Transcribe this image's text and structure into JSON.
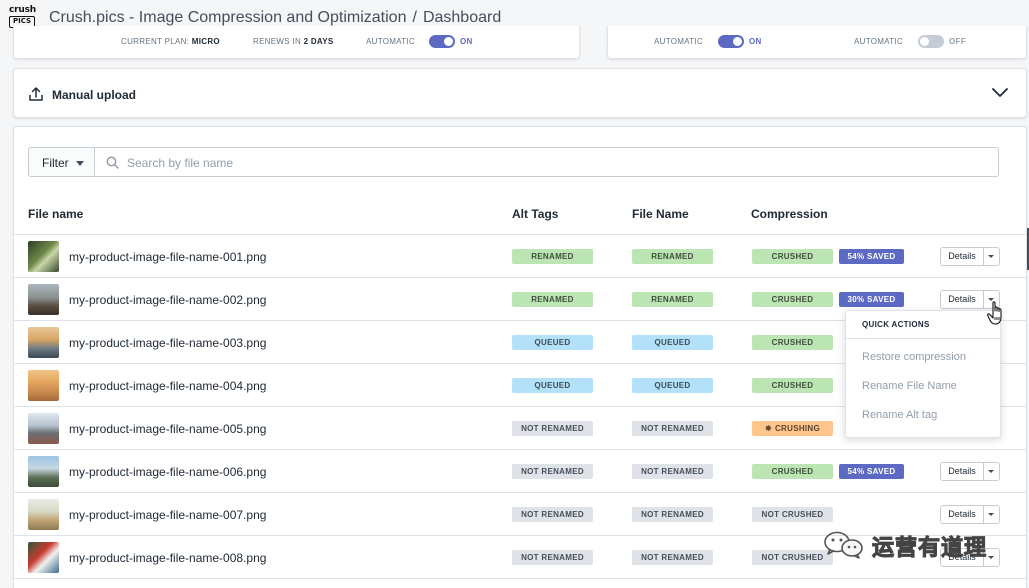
{
  "header": {
    "logo_top": "crush",
    "logo_bottom": "PICS",
    "app_title": "Crush.pics - Image Compression and Optimization",
    "separator": "/",
    "page": "Dashboard"
  },
  "plan": {
    "current_plan_label": "CURRENT PLAN:",
    "current_plan_value": "MICRO",
    "renews_label": "RENEWS IN",
    "renews_value": "2 DAYS",
    "toggles": [
      {
        "label": "AUTOMATIC",
        "state": "ON",
        "on": true
      },
      {
        "label": "AUTOMATIC",
        "state": "ON",
        "on": true
      },
      {
        "label": "AUTOMATIC",
        "state": "OFF",
        "on": false
      }
    ]
  },
  "upload": {
    "label": "Manual upload",
    "icon": "upload-icon"
  },
  "filter": {
    "label": "Filter",
    "search_placeholder": "Search by file name",
    "search_value": ""
  },
  "columns": [
    "File name",
    "Alt Tags",
    "File Name",
    "Compression"
  ],
  "rows": [
    {
      "file": "my-product-image-file-name-001.png",
      "alt": "RENAMED",
      "alt_kind": "green",
      "name": "RENAMED",
      "name_kind": "green",
      "comp": "CRUSHED",
      "comp_kind": "green",
      "saved": "54% SAVED",
      "details": "Details"
    },
    {
      "file": "my-product-image-file-name-002.png",
      "alt": "RENAMED",
      "alt_kind": "green",
      "name": "RENAMED",
      "name_kind": "green",
      "comp": "CRUSHED",
      "comp_kind": "green",
      "saved": "30% SAVED",
      "details": "Details"
    },
    {
      "file": "my-product-image-file-name-003.png",
      "alt": "QUEUED",
      "alt_kind": "blue",
      "name": "QUEUED",
      "name_kind": "blue",
      "comp": "CRUSHED",
      "comp_kind": "green",
      "saved": "",
      "details": ""
    },
    {
      "file": "my-product-image-file-name-004.png",
      "alt": "QUEUED",
      "alt_kind": "blue",
      "name": "QUEUED",
      "name_kind": "blue",
      "comp": "CRUSHED",
      "comp_kind": "green",
      "saved": "",
      "details": ""
    },
    {
      "file": "my-product-image-file-name-005.png",
      "alt": "NOT RENAMED",
      "alt_kind": "grey",
      "name": "NOT RENAMED",
      "name_kind": "grey",
      "comp": "CRUSHING",
      "comp_kind": "orange",
      "saved": "",
      "details": ""
    },
    {
      "file": "my-product-image-file-name-006.png",
      "alt": "NOT RENAMED",
      "alt_kind": "grey",
      "name": "NOT RENAMED",
      "name_kind": "grey",
      "comp": "CRUSHED",
      "comp_kind": "green",
      "saved": "54% SAVED",
      "details": "Details"
    },
    {
      "file": "my-product-image-file-name-007.png",
      "alt": "NOT RENAMED",
      "alt_kind": "grey",
      "name": "NOT RENAMED",
      "name_kind": "grey",
      "comp": "NOT CRUSHED",
      "comp_kind": "grey",
      "saved": "",
      "details": "Details"
    },
    {
      "file": "my-product-image-file-name-008.png",
      "alt": "NOT RENAMED",
      "alt_kind": "grey",
      "name": "NOT RENAMED",
      "name_kind": "grey",
      "comp": "NOT CRUSHED",
      "comp_kind": "grey",
      "saved": "",
      "details": "Details"
    }
  ],
  "quick_actions": {
    "title": "QUICK ACTIONS",
    "items": [
      "Restore compression",
      "Rename File Name",
      "Rename Alt tag"
    ]
  },
  "watermark": {
    "text": "运营有道理"
  },
  "colors": {
    "accent": "#5c6ac4",
    "green": "#bbe5b3",
    "blue": "#b4e1fa",
    "grey": "#dfe3e8",
    "orange": "#ffc58b"
  }
}
